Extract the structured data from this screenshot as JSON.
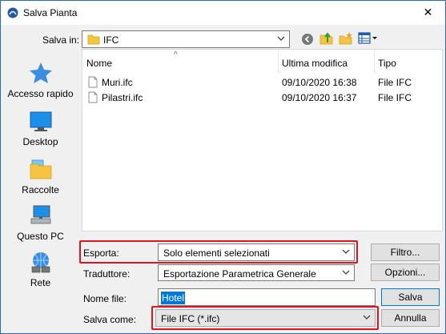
{
  "window": {
    "title": "Salva Pianta",
    "close_glyph": "✕"
  },
  "toolbar": {
    "save_in_label": "Salva in:",
    "save_in_value": "IFC",
    "back_icon": "back-icon",
    "up_icon": "up-folder-icon",
    "new_folder_icon": "new-folder-icon",
    "view_menu_icon": "view-menu-icon"
  },
  "places": [
    {
      "label": "Accesso rapido",
      "icon": "quick-access-star-icon"
    },
    {
      "label": "Desktop",
      "icon": "desktop-icon"
    },
    {
      "label": "Raccolte",
      "icon": "libraries-icon"
    },
    {
      "label": "Questo PC",
      "icon": "this-pc-icon"
    },
    {
      "label": "Rete",
      "icon": "network-icon"
    }
  ],
  "file_list": {
    "columns": [
      "Nome",
      "Ultima modifica",
      "Tipo"
    ],
    "sort_glyph": "^",
    "rows": [
      {
        "name": "Muri.ifc",
        "modified": "09/10/2020 16:38",
        "type": "File IFC"
      },
      {
        "name": "Pilastri.ifc",
        "modified": "09/10/2020 16:37",
        "type": "File IFC"
      }
    ]
  },
  "form": {
    "export_label": "Esporta:",
    "export_value": "Solo elementi selezionati",
    "translator_label": "Traduttore:",
    "translator_value": "Esportazione Parametrica Generale",
    "filename_label": "Nome file:",
    "filename_value": "Hotel",
    "save_as_label": "Salva come:",
    "save_as_value": "File IFC (*.ifc)"
  },
  "buttons": {
    "filter": "Filtro...",
    "options": "Opzioni...",
    "save": "Salva",
    "cancel": "Annulla"
  },
  "colors": {
    "highlight_box": "#e0141e",
    "selection": "#0078d7",
    "title_border": "#2b6bb5"
  }
}
